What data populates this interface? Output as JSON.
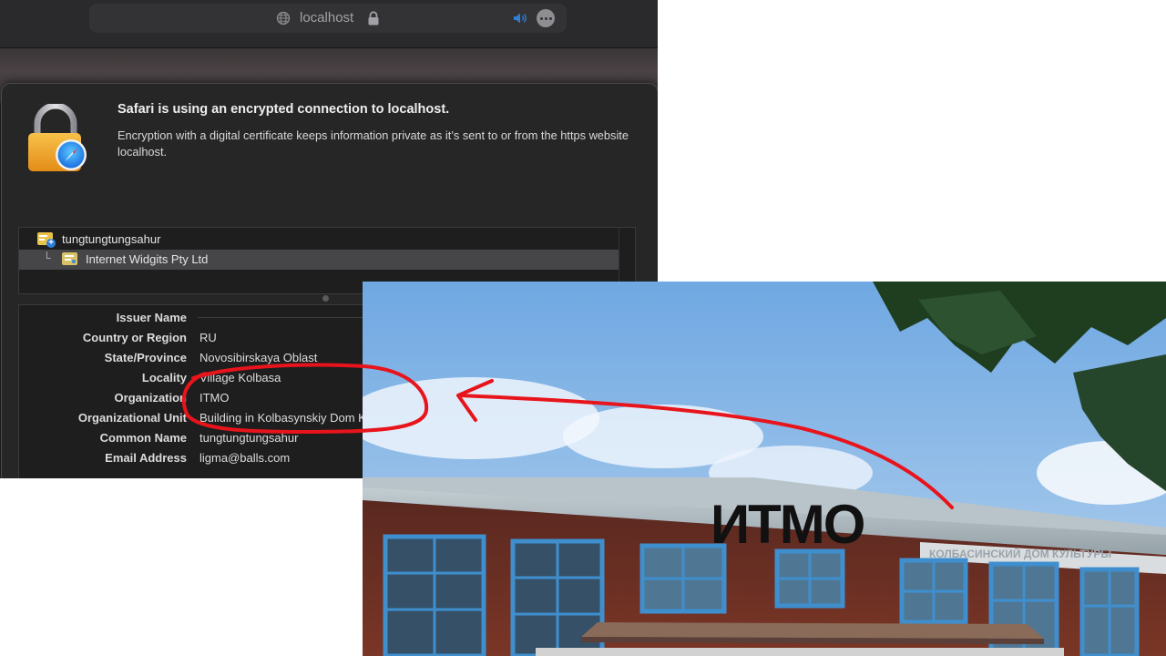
{
  "toolbar": {
    "url": "localhost"
  },
  "dialog": {
    "headline": "Safari is using an encrypted connection to localhost.",
    "body": "Encryption with a digital certificate keeps information private as it’s sent to or from the https website localhost."
  },
  "chain": [
    {
      "label": "tungtungtungsahur",
      "icon": "root-certificate-icon"
    },
    {
      "label": "Internet Widgits Pty Ltd",
      "icon": "certificate-icon",
      "selected": true
    }
  ],
  "details": {
    "section_title": "Issuer Name",
    "fields": [
      {
        "label": "Country or Region",
        "value": "RU"
      },
      {
        "label": "State/Province",
        "value": "Novosibirskaya Oblast"
      },
      {
        "label": "Locality",
        "value": "Village Kolbasa"
      },
      {
        "label": "Organization",
        "value": "ITMO"
      },
      {
        "label": "Organizational Unit",
        "value": "Building in Kolbasynskiy Dom Kulturi"
      },
      {
        "label": "Common Name",
        "value": "tungtungtungsahur"
      },
      {
        "label": "Email Address",
        "value": "ligma@balls.com"
      }
    ]
  },
  "photo": {
    "logo": "ИТМО",
    "building_sign": "КОЛБАСИНСКИЙ ДОМ КУЛЬТУРЫ"
  },
  "colors": {
    "annotation": "#e8141b",
    "window_bg": "#232325",
    "sky": "#7fb2e6",
    "brick": "#6a2d22",
    "window_frame": "#3f8fcf"
  }
}
